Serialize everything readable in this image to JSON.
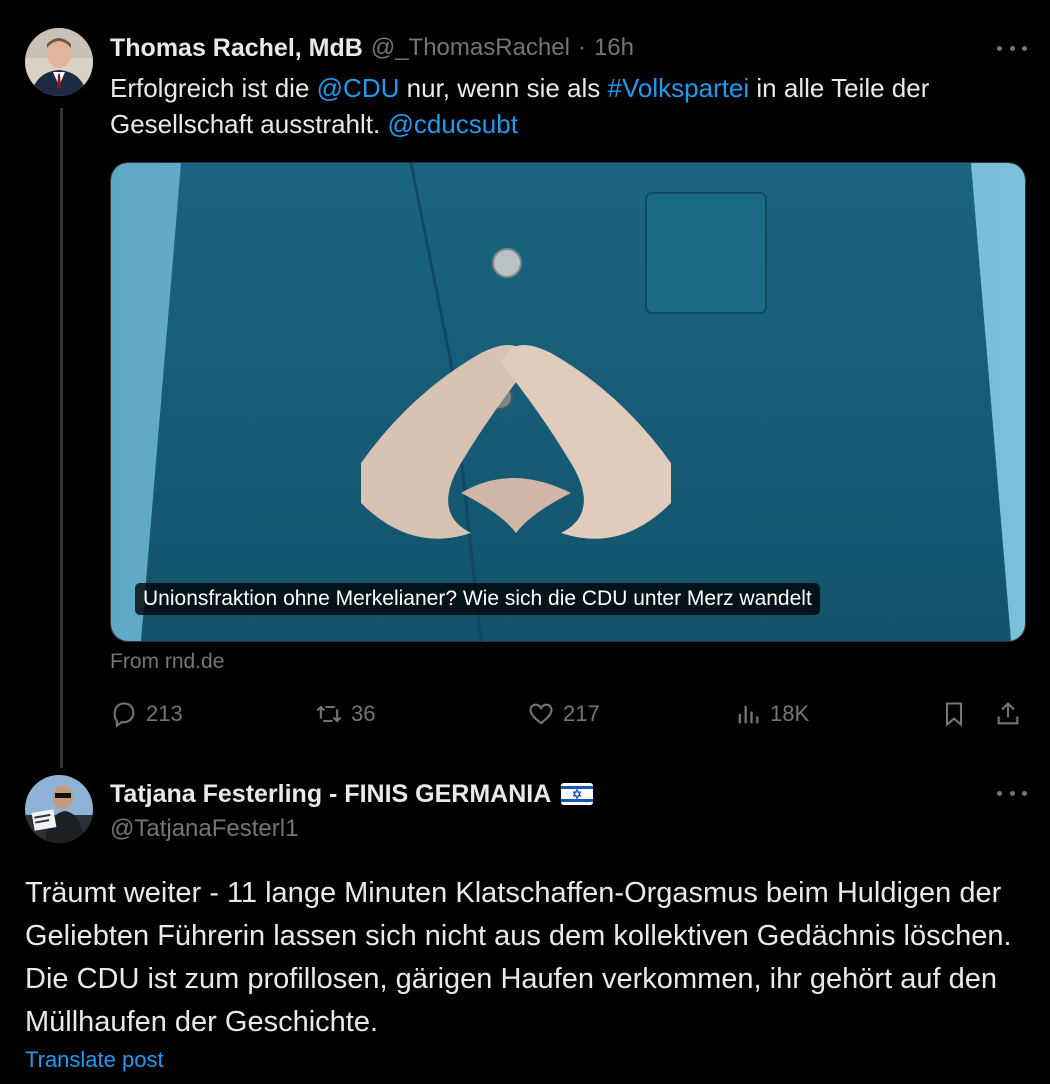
{
  "post1": {
    "author_name": "Thomas Rachel, MdB",
    "handle": "@_ThomasRachel",
    "separator": "·",
    "time": "16h",
    "text_parts": [
      {
        "text": "Erfolgreich ist die ",
        "type": "plain"
      },
      {
        "text": "@CDU",
        "type": "link"
      },
      {
        "text": " nur, wenn sie als ",
        "type": "plain"
      },
      {
        "text": "#Volkspartei",
        "type": "link"
      },
      {
        "text": " in alle Teile der Gesellschaft ausstrahlt. ",
        "type": "plain"
      },
      {
        "text": "@cducsubt",
        "type": "link"
      }
    ],
    "card": {
      "caption": "Unionsfraktion ohne Merkelianer? Wie sich die CDU unter Merz wandelt",
      "source": "From rnd.de"
    },
    "metrics": {
      "replies": "213",
      "reposts": "36",
      "likes": "217",
      "views": "18K"
    }
  },
  "post2": {
    "author_name": "Tatjana Festerling - FINIS GERMANIA",
    "flag_icon": "israel-flag-icon",
    "handle": "@TatjanaFesterl1",
    "text": "Träumt weiter - 11 lange Minuten Klatschaffen-Orgasmus beim Huldigen der Geliebten Führerin lassen sich nicht aus dem kollektiven Gedächnis löschen. Die CDU ist zum profillosen, gärigen Haufen verkommen, ihr gehört auf den Müllhaufen der Geschichte.",
    "translate_label": "Translate post"
  },
  "colors": {
    "background": "#000000",
    "text": "#e7e9ea",
    "muted": "#71767b",
    "link": "#1d9bf0",
    "jacket": "#1f6b86",
    "backdrop": "#6fb3cf"
  }
}
